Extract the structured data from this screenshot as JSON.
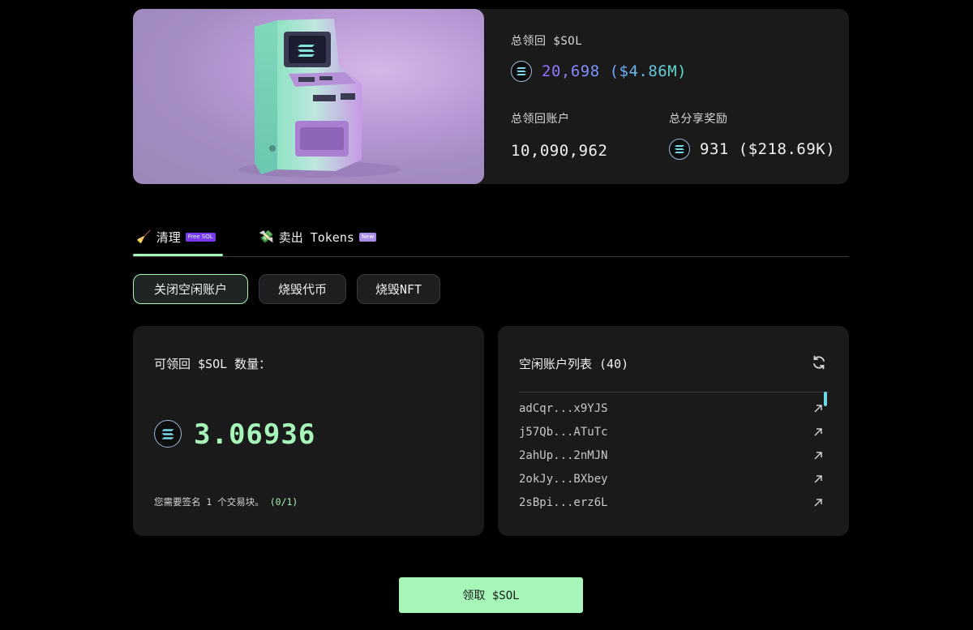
{
  "stats": {
    "total_reclaimed_label": "总领回 $SOL",
    "total_reclaimed_value": "20,698 ($4.86M)",
    "total_accounts_label": "总领回账户",
    "total_accounts_value": "10,090,962",
    "total_referral_label": "总分享奖励",
    "total_referral_value": "931 ($218.69K)"
  },
  "tabs": [
    {
      "icon": "🧹",
      "label": "清理",
      "badge": "Free SOL"
    },
    {
      "icon": "💸",
      "label": "卖出 Tokens",
      "badge": "New"
    }
  ],
  "sub_actions": [
    "关闭空闲账户",
    "烧毁代币",
    "烧毁NFT"
  ],
  "claimable": {
    "label": "可领回 $SOL 数量：",
    "amount": "3.06936",
    "hint_text": "您需要签名 1 个交易块。",
    "hint_progress": "(0/1)"
  },
  "idle_accounts": {
    "title": "空闲账户列表 (40)",
    "rows": [
      "adCqr...x9YJS",
      "j57Qb...ATuTc",
      "2ahUp...2nMJN",
      "2okJy...BXbey",
      "2sBpi...erz6L"
    ]
  },
  "claim_button": "领取 $SOL",
  "colors": {
    "accent": "#a6f5b9",
    "panel": "#1a1a1b",
    "background": "#000000"
  }
}
